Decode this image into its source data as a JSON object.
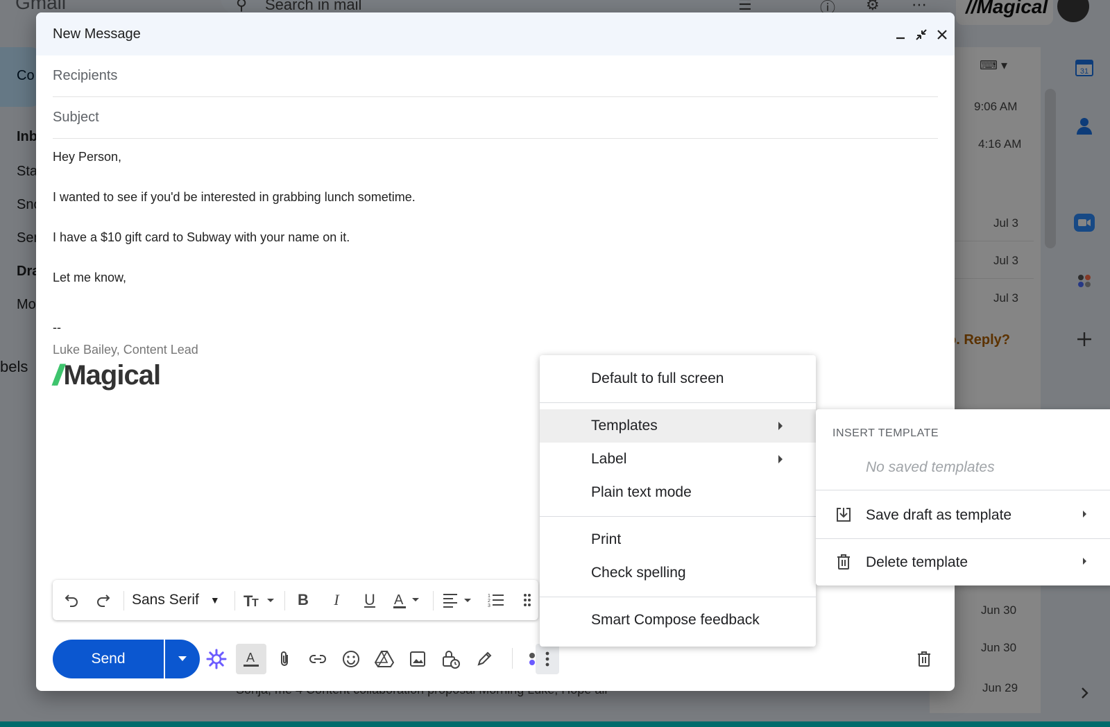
{
  "background": {
    "app_logo": "Gmail",
    "search_placeholder": "Search in mail",
    "brand": "//Magical",
    "compose_label": "Co",
    "nav": [
      "Inb",
      "Sta",
      "Sno",
      "Sen",
      "Dra",
      "Mo"
    ],
    "labels_heading": "bels",
    "dates": [
      "9:06 AM",
      "4:16 AM",
      "Jul 3",
      "Jul 3",
      "Jul 3",
      "Jun 30",
      "Jun 30",
      "Jun 29"
    ],
    "reply_text": "o. Reply?",
    "bottom_row": "Sonja, me 4         Content collaboration proposal      Morning Luke, Hope all"
  },
  "compose": {
    "title": "New Message",
    "recipients_placeholder": "Recipients",
    "subject_placeholder": "Subject",
    "body_lines": [
      "Hey Person,",
      "I wanted to see if you'd be interested in grabbing lunch sometime.",
      "I have a $10 gift card to Subway with your name on it.",
      "Let me know,"
    ],
    "signature_dash": "--",
    "signature_name": "Luke Bailey, Content Lead",
    "signature_logo_slash": "//",
    "signature_logo_text": "Magical",
    "send_label": "Send",
    "font_name": "Sans Serif"
  },
  "more_menu": {
    "items": {
      "default_full_screen": "Default to full screen",
      "templates": "Templates",
      "label": "Label",
      "plain_text": "Plain text mode",
      "print": "Print",
      "check_spelling": "Check spelling",
      "smart_compose": "Smart Compose feedback"
    }
  },
  "templates_menu": {
    "heading": "INSERT TEMPLATE",
    "empty": "No saved templates",
    "save_draft": "Save draft as template",
    "delete": "Delete template"
  },
  "colors": {
    "send_blue": "#0b57d0",
    "header_bg": "#f2f6fc",
    "ai_purple": "#6b5bff",
    "logo_green": "#3ec46d"
  }
}
